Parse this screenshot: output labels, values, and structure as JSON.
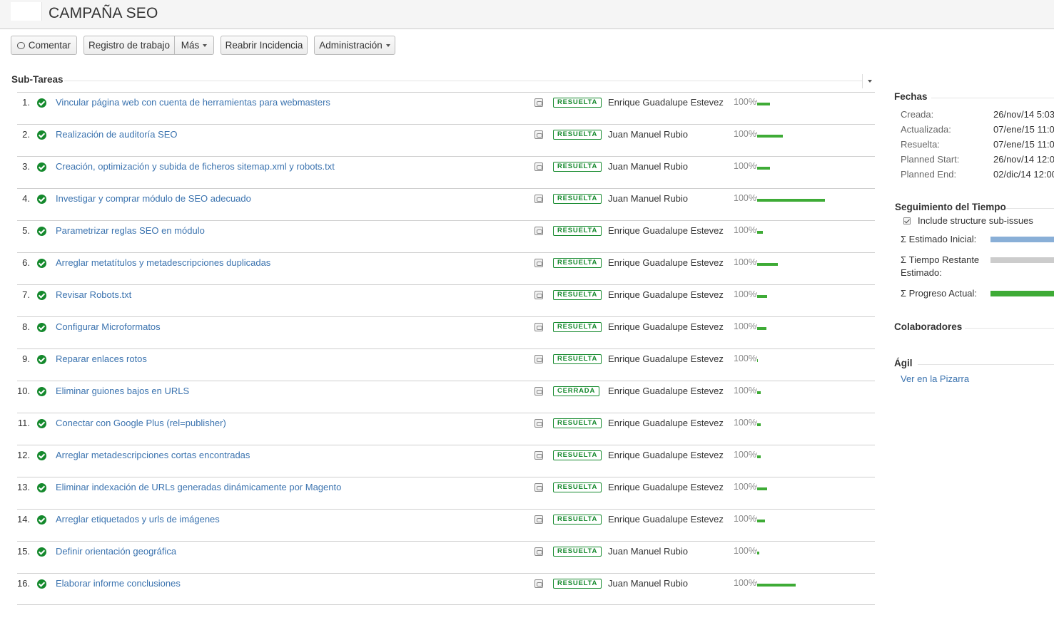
{
  "header": {
    "title": "CAMPAÑA SEO"
  },
  "toolbar": {
    "comment_label": "Comentar",
    "worklog_label": "Registro de trabajo",
    "more_label": "Más",
    "reopen_label": "Reabrir Incidencia",
    "admin_label": "Administración"
  },
  "subtasks": {
    "title": "Sub-Tareas",
    "items": [
      {
        "num": "1.",
        "summary": "Vincular página web con cuenta de herramientas para webmasters",
        "status": "RESUELTA",
        "assignee": "Enrique Guadalupe Estevez",
        "progress": "100%",
        "bar": 18
      },
      {
        "num": "2.",
        "summary": "Realización de auditoría SEO",
        "status": "RESUELTA",
        "assignee": "Juan Manuel Rubio",
        "progress": "100%",
        "bar": 36
      },
      {
        "num": "3.",
        "summary": "Creación, optimización y subida de ficheros sitemap.xml y robots.txt",
        "status": "RESUELTA",
        "assignee": "Juan Manuel Rubio",
        "progress": "100%",
        "bar": 18
      },
      {
        "num": "4.",
        "summary": "Investigar y comprar módulo de SEO adecuado",
        "status": "RESUELTA",
        "assignee": "Juan Manuel Rubio",
        "progress": "100%",
        "bar": 95
      },
      {
        "num": "5.",
        "summary": "Parametrizar reglas SEO en módulo",
        "status": "RESUELTA",
        "assignee": "Enrique Guadalupe Estevez",
        "progress": "100%",
        "bar": 8
      },
      {
        "num": "6.",
        "summary": "Arreglar metatítulos y metadescripciones duplicadas",
        "status": "RESUELTA",
        "assignee": "Enrique Guadalupe Estevez",
        "progress": "100%",
        "bar": 29
      },
      {
        "num": "7.",
        "summary": "Revisar Robots.txt",
        "status": "RESUELTA",
        "assignee": "Enrique Guadalupe Estevez",
        "progress": "100%",
        "bar": 14
      },
      {
        "num": "8.",
        "summary": "Configurar Microformatos",
        "status": "RESUELTA",
        "assignee": "Enrique Guadalupe Estevez",
        "progress": "100%",
        "bar": 13
      },
      {
        "num": "9.",
        "summary": "Reparar enlaces rotos",
        "status": "RESUELTA",
        "assignee": "Enrique Guadalupe Estevez",
        "progress": "100%",
        "bar": 1
      },
      {
        "num": "10.",
        "summary": "Eliminar guiones bajos en URLS",
        "status": "CERRADA",
        "assignee": "Enrique Guadalupe Estevez",
        "progress": "100%",
        "bar": 5
      },
      {
        "num": "11.",
        "summary": "Conectar con Google Plus (rel=publisher)",
        "status": "RESUELTA",
        "assignee": "Enrique Guadalupe Estevez",
        "progress": "100%",
        "bar": 5
      },
      {
        "num": "12.",
        "summary": "Arreglar metadescripciones cortas encontradas",
        "status": "RESUELTA",
        "assignee": "Enrique Guadalupe Estevez",
        "progress": "100%",
        "bar": 5
      },
      {
        "num": "13.",
        "summary": "Eliminar indexación de URLs generadas dinámicamente por Magento",
        "status": "RESUELTA",
        "assignee": "Enrique Guadalupe Estevez",
        "progress": "100%",
        "bar": 14
      },
      {
        "num": "14.",
        "summary": "Arreglar etiquetados y urls de imágenes",
        "status": "RESUELTA",
        "assignee": "Enrique Guadalupe Estevez",
        "progress": "100%",
        "bar": 11
      },
      {
        "num": "15.",
        "summary": "Definir orientación geográfica",
        "status": "RESUELTA",
        "assignee": "Juan Manuel Rubio",
        "progress": "100%",
        "bar": 3
      },
      {
        "num": "16.",
        "summary": "Elaborar informe conclusiones",
        "status": "RESUELTA",
        "assignee": "Juan Manuel Rubio",
        "progress": "100%",
        "bar": 54
      }
    ]
  },
  "dates": {
    "title": "Fechas",
    "rows": [
      {
        "label": "Creada:",
        "value": "26/nov/14 5:03"
      },
      {
        "label": "Actualizada:",
        "value": "07/ene/15 11:0"
      },
      {
        "label": "Resuelta:",
        "value": "07/ene/15 11:0"
      },
      {
        "label": "Planned Start:",
        "value": "26/nov/14 12:0"
      },
      {
        "label": "Planned End:",
        "value": "02/dic/14 12:00"
      }
    ]
  },
  "time_tracking": {
    "title": "Seguimiento del Tiempo",
    "include_label": "Include structure sub-issues",
    "estimated_label": "Σ Estimado Inicial:",
    "remaining_label": "Σ Tiempo Restante Estimado:",
    "progress_label": "Σ Progreso Actual:"
  },
  "collaborators": {
    "title": "Colaboradores"
  },
  "agile": {
    "title": "Ágil",
    "link": "Ver en la Pizarra"
  },
  "colors": {
    "link": "#3b73af",
    "status_green": "#14892c",
    "progress_green": "#3eab36",
    "estimated_blue": "#89afd7",
    "remaining_gray": "#cccccc"
  }
}
